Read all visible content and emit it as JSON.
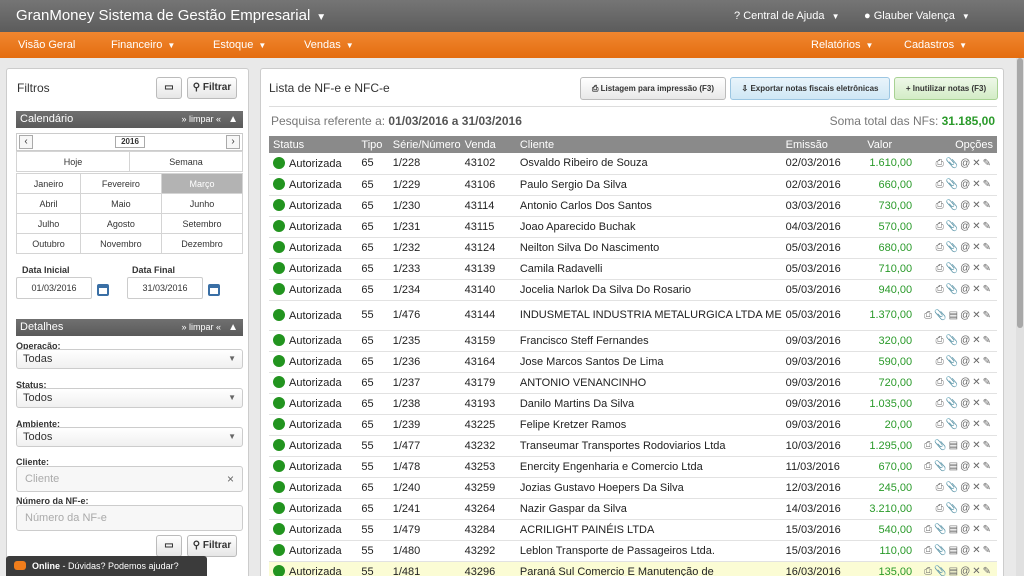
{
  "header": {
    "brand": "GranMoney Sistema de Gestão Empresarial",
    "help": "Central de Ajuda",
    "user": "Glauber Valença"
  },
  "nav": {
    "items": [
      "Visão Geral",
      "Financeiro",
      "Estoque",
      "Vendas"
    ],
    "right": [
      "Relatórios",
      "Cadastros"
    ]
  },
  "filters": {
    "title": "Filtros",
    "filter_btn": "Filtrar",
    "calendar_title": "Calendário",
    "limpar": "» limpar «",
    "year": "2016",
    "today": "Hoje",
    "week": "Semana",
    "months": [
      [
        "Janeiro",
        "Fevereiro",
        "Março"
      ],
      [
        "Abril",
        "Maio",
        "Junho"
      ],
      [
        "Julho",
        "Agosto",
        "Setembro"
      ],
      [
        "Outubro",
        "Novembro",
        "Dezembro"
      ]
    ],
    "selected_month": "Março",
    "start_label": "Data Inicial",
    "start_value": "01/03/2016",
    "end_label": "Data Final",
    "end_value": "31/03/2016",
    "details_title": "Detalhes",
    "operacao_label": "Operação:",
    "operacao_value": "Todas",
    "status_label": "Status:",
    "status_value": "Todos",
    "ambiente_label": "Ambiente:",
    "ambiente_value": "Todos",
    "cliente_label": "Cliente:",
    "cliente_placeholder": "Cliente",
    "numero_label": "Número da NF-e:",
    "numero_placeholder": "Número da NF-e"
  },
  "chat": {
    "text_bold": "Online",
    "text": " - Dúvidas? Podemos ajudar?"
  },
  "main": {
    "title": "Lista de NF-e e NFC-e",
    "btn_print": "Listagem para impressão (F3)",
    "btn_export": "Exportar notas fiscais eletrônicas",
    "btn_invalidate": "Inutilizar notas (F3)",
    "period_prefix": "Pesquisa referente a: ",
    "period_value": "01/03/2016 a 31/03/2016",
    "total_prefix": "Soma total das NFs: ",
    "total_value": "31.185,00",
    "columns": [
      "Status",
      "Tipo",
      "Série/Número",
      "Venda",
      "Cliente",
      "Emissão",
      "Valor",
      "Opções"
    ],
    "rows": [
      [
        "Autorizada",
        "65",
        "1/228",
        "43102",
        "Osvaldo Ribeiro de Souza",
        "02/03/2016",
        "1.610,00"
      ],
      [
        "Autorizada",
        "65",
        "1/229",
        "43106",
        "Paulo Sergio Da Silva",
        "02/03/2016",
        "660,00"
      ],
      [
        "Autorizada",
        "65",
        "1/230",
        "43114",
        "Antonio Carlos Dos Santos",
        "03/03/2016",
        "730,00"
      ],
      [
        "Autorizada",
        "65",
        "1/231",
        "43115",
        "Joao Aparecido Buchak",
        "04/03/2016",
        "570,00"
      ],
      [
        "Autorizada",
        "65",
        "1/232",
        "43124",
        "Neilton Silva Do Nascimento",
        "05/03/2016",
        "680,00"
      ],
      [
        "Autorizada",
        "65",
        "1/233",
        "43139",
        "Camila Radavelli",
        "05/03/2016",
        "710,00"
      ],
      [
        "Autorizada",
        "65",
        "1/234",
        "43140",
        "Jocelia Narlok Da Silva Do Rosario",
        "05/03/2016",
        "940,00"
      ],
      [
        "Autorizada",
        "55",
        "1/476",
        "43144",
        "INDUSMETAL INDUSTRIA METALURGICA LTDA ME",
        "05/03/2016",
        "1.370,00"
      ],
      [
        "Autorizada",
        "65",
        "1/235",
        "43159",
        "Francisco Steff Fernandes",
        "09/03/2016",
        "320,00"
      ],
      [
        "Autorizada",
        "65",
        "1/236",
        "43164",
        "Jose Marcos Santos De Lima",
        "09/03/2016",
        "590,00"
      ],
      [
        "Autorizada",
        "65",
        "1/237",
        "43179",
        "ANTONIO VENANCINHO",
        "09/03/2016",
        "720,00"
      ],
      [
        "Autorizada",
        "65",
        "1/238",
        "43193",
        "Danilo Martins Da Silva",
        "09/03/2016",
        "1.035,00"
      ],
      [
        "Autorizada",
        "65",
        "1/239",
        "43225",
        "Felipe Kretzer Ramos",
        "09/03/2016",
        "20,00"
      ],
      [
        "Autorizada",
        "55",
        "1/477",
        "43232",
        "Transeumar Transportes Rodoviarios Ltda",
        "10/03/2016",
        "1.295,00"
      ],
      [
        "Autorizada",
        "55",
        "1/478",
        "43253",
        "Enercity Engenharia e Comercio Ltda",
        "11/03/2016",
        "670,00"
      ],
      [
        "Autorizada",
        "65",
        "1/240",
        "43259",
        "Jozias Gustavo Hoepers Da Silva",
        "12/03/2016",
        "245,00"
      ],
      [
        "Autorizada",
        "65",
        "1/241",
        "43264",
        "Nazir Gaspar da Silva",
        "14/03/2016",
        "3.210,00"
      ],
      [
        "Autorizada",
        "55",
        "1/479",
        "43284",
        "ACRILIGHT PAINÉIS LTDA",
        "15/03/2016",
        "540,00"
      ],
      [
        "Autorizada",
        "55",
        "1/480",
        "43292",
        "Leblon Transporte de Passageiros Ltda.",
        "15/03/2016",
        "110,00"
      ],
      [
        "Autorizada",
        "55",
        "1/481",
        "43296",
        "Paraná Sul Comercio E Manutenção de",
        "16/03/2016",
        "135,00"
      ]
    ]
  }
}
